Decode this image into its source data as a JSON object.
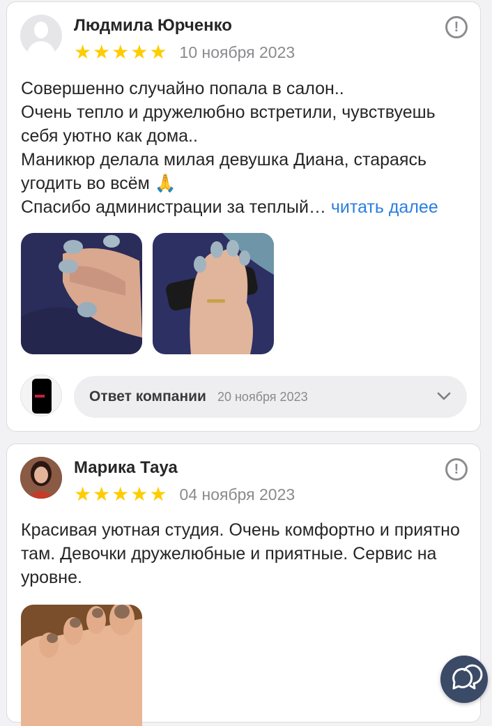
{
  "reviews": [
    {
      "author": "Людмила Юрченко",
      "stars": 5,
      "date": "10 ноября 2023",
      "text_lines": [
        "Совершенно случайно попала в салон..",
        "Очень тепло и дружелюбно встретили, чувствуешь себя уютно как дома..",
        "Маникюр делала милая девушка Диана, стараясь угодить во всём 🙏"
      ],
      "text_last": "Спасибо администрации за теплый…",
      "read_more": "читать далее",
      "company_reply": {
        "label": "Ответ компании",
        "date": "20 ноября 2023"
      }
    },
    {
      "author": "Марика Тауа",
      "stars": 5,
      "date": "04 ноября 2023",
      "text": "Красивая уютная студия. Очень комфортно и приятно там. Девочки дружелюбные и приятные. Сервис на уровне."
    }
  ],
  "icons": {
    "star": "star-icon",
    "complain": "exclamation-circle-icon",
    "chevron": "chevron-down-icon",
    "chat": "chat-bubbles-icon"
  },
  "colors": {
    "star": "#ffcc00",
    "link": "#2b7ee0",
    "fab": "#3b4a66"
  }
}
